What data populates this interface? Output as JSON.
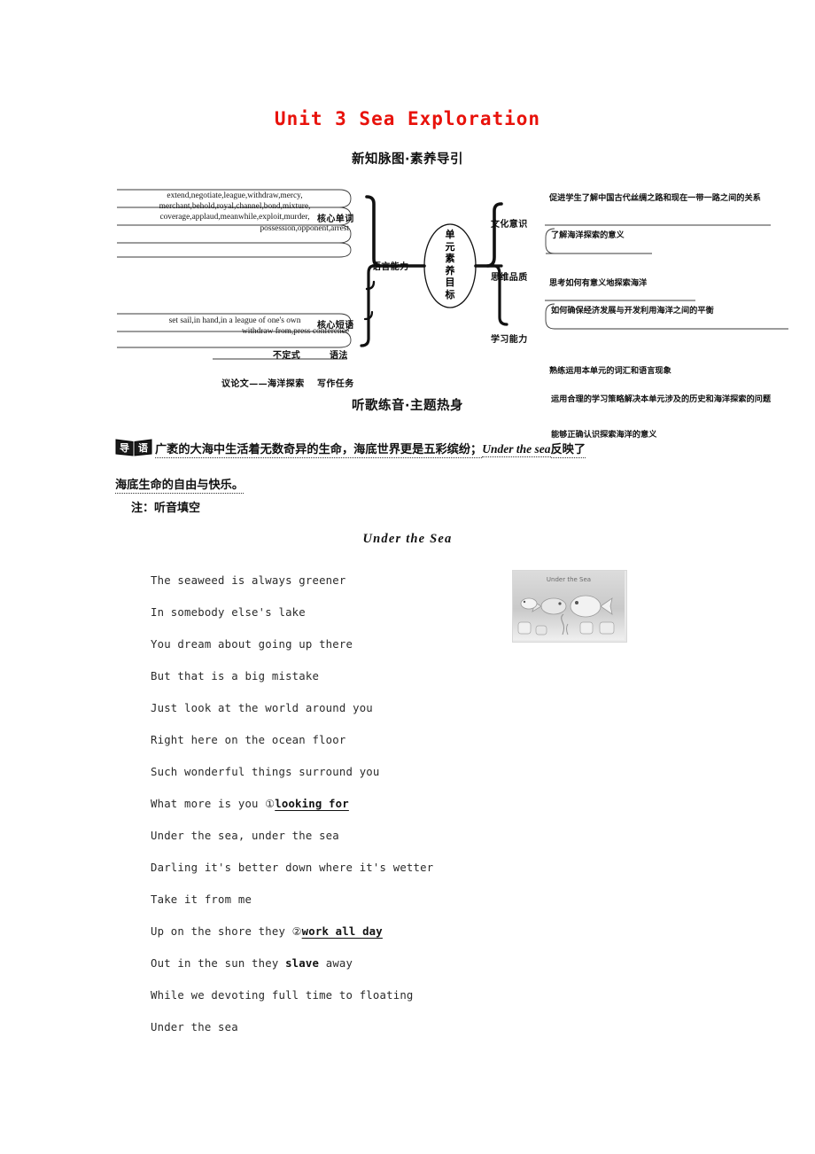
{
  "page": {
    "unit_title": "Unit 3  Sea Exploration",
    "section_heads": {
      "mindmap": "新知脉图·素养导引",
      "song": "听歌练音·主题热身"
    },
    "note": "注：听音填空"
  },
  "mindmap": {
    "center": "单元素养目标",
    "left_branch": {
      "label": "语言能力",
      "nodes": [
        {
          "label": "核心单词",
          "lines": [
            "extend,negotiate,league,withdraw,mercy,",
            "merchant,behold,royal,channel,bond,mixture,",
            "coverage,applaud,meanwhile,exploit,murder,",
            "possession,opponent,arrest"
          ]
        },
        {
          "label": "核心短语",
          "lines": [
            "set sail,in hand,in a league of one's own",
            "withdraw from,press conference"
          ]
        },
        {
          "label": "语法",
          "lines": [
            "不定式"
          ]
        },
        {
          "label": "写作任务",
          "lines": [
            "议论文——海洋探索"
          ]
        }
      ]
    },
    "right_branches": [
      {
        "label": "文化意识",
        "items": [
          "促进学生了解中国古代丝绸之路和现在一带一路之间的关系",
          "了解海洋探索的意义"
        ]
      },
      {
        "label": "思维品质",
        "items": [
          "思考如何有意义地探索海洋",
          "如何确保经济发展与开发利用海洋之间的平衡"
        ]
      },
      {
        "label": "学习能力",
        "items": [
          "熟练运用本单元的词汇和语言现象",
          "运用合理的学习策略解决本单元涉及的历史和海洋探索的问题",
          "能够正确认识探索海洋的意义"
        ]
      }
    ]
  },
  "intro": {
    "badge_label": "导语",
    "text_part1": "广袤的大海中生活着无数奇异的生命，海底世界更是五彩缤纷；",
    "text_em": "Under the sea",
    "text_part2": "反映了",
    "text_line2": "海底生命的自由与快乐。"
  },
  "song": {
    "title": "Under the Sea",
    "lines": [
      {
        "pre": "The seaweed is always greener",
        "num": "",
        "blank": "",
        "post": ""
      },
      {
        "pre": "In somebody else's lake",
        "num": "",
        "blank": "",
        "post": ""
      },
      {
        "pre": "You dream about going up there",
        "num": "",
        "blank": "",
        "post": ""
      },
      {
        "pre": "But that is a big mistake",
        "num": "",
        "blank": "",
        "post": ""
      },
      {
        "pre": "Just look at the world around you",
        "num": "",
        "blank": "",
        "post": ""
      },
      {
        "pre": "Right here on the ocean floor",
        "num": "",
        "blank": "",
        "post": ""
      },
      {
        "pre": "Such wonderful things surround you",
        "num": "",
        "blank": "",
        "post": ""
      },
      {
        "pre": "What more is you ",
        "num": "①",
        "blank": "looking for",
        "post": ""
      },
      {
        "pre": "Under the sea, under the sea",
        "num": "",
        "blank": "",
        "post": ""
      },
      {
        "pre": "Darling it's better down where it's wetter",
        "num": "",
        "blank": "",
        "post": ""
      },
      {
        "pre": "Take it from me",
        "num": "",
        "blank": "",
        "post": ""
      },
      {
        "pre": "Up on the shore they ",
        "num": "②",
        "blank": "work all day  ",
        "post": ""
      },
      {
        "pre": "Out in the sun they ",
        "num": "",
        "blank": "",
        "post": "",
        "bold": "slave",
        "tail": " away"
      },
      {
        "pre": "While we devoting full time to floating",
        "num": "",
        "blank": "",
        "post": ""
      },
      {
        "pre": "Under the sea",
        "num": "",
        "blank": "",
        "post": ""
      }
    ],
    "illustration_caption": "Under the Sea"
  },
  "colors": {
    "title_red": "#e8120b",
    "text_black": "#141414"
  }
}
